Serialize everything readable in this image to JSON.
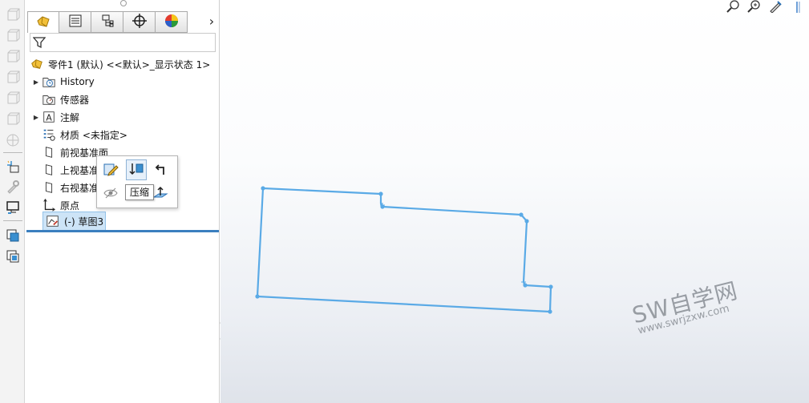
{
  "feature_tree": {
    "root": {
      "label": "零件1 (默认) <<默认>_显示状态 1>"
    },
    "items": [
      {
        "label": "History",
        "expandable": true,
        "icon": "history-folder-icon"
      },
      {
        "label": "传感器",
        "expandable": false,
        "icon": "sensor-folder-icon"
      },
      {
        "label": "注解",
        "expandable": true,
        "icon": "annotation-icon"
      },
      {
        "label": "材质 <未指定>",
        "expandable": false,
        "icon": "material-icon"
      },
      {
        "label": "前视基准面",
        "expandable": false,
        "icon": "plane-icon"
      },
      {
        "label": "上视基准面",
        "expandable": false,
        "icon": "plane-icon"
      },
      {
        "label": "右视基准面",
        "expandable": false,
        "icon": "plane-icon"
      },
      {
        "label": "原点",
        "expandable": false,
        "icon": "origin-icon"
      },
      {
        "label": "(-) 草图3",
        "expandable": false,
        "icon": "sketch-icon",
        "selected": true
      }
    ]
  },
  "panel_tabs": [
    {
      "name": "featuremanager-tab",
      "icon": "part-icon",
      "active": true
    },
    {
      "name": "propertymanager-tab",
      "icon": "property-list-icon",
      "active": false
    },
    {
      "name": "configurationmanager-tab",
      "icon": "configuration-icon",
      "active": false
    },
    {
      "name": "dimxpert-tab",
      "icon": "crosshair-icon",
      "active": false
    },
    {
      "name": "display-manager-tab",
      "icon": "appearance-ball-icon",
      "active": false
    }
  ],
  "context_toolbar": {
    "buttons": [
      "edit-sketch",
      "suppress",
      "rollback",
      "hide",
      "normal-to"
    ],
    "tooltip": "压缩"
  },
  "watermark": {
    "title": "SW自学网",
    "url": "www.swrjzxw.com"
  },
  "colors": {
    "sketch_line": "#5aaae6",
    "selection": "#cde4f7",
    "rollback_bar": "#3b7fbf"
  }
}
